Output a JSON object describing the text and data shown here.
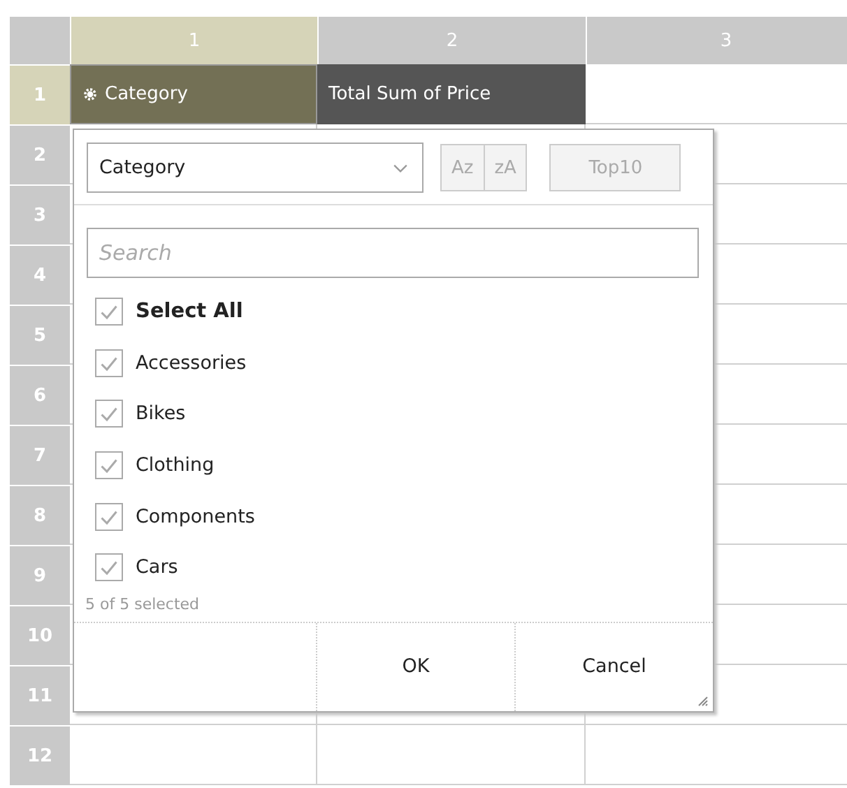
{
  "grid": {
    "columns": [
      {
        "label": "1",
        "selected": true
      },
      {
        "label": "2",
        "selected": false
      },
      {
        "label": "3",
        "selected": false
      }
    ],
    "rows": [
      {
        "label": "1",
        "selected": true
      },
      {
        "label": "2",
        "selected": false
      },
      {
        "label": "3",
        "selected": false
      },
      {
        "label": "4",
        "selected": false
      },
      {
        "label": "5",
        "selected": false
      },
      {
        "label": "6",
        "selected": false
      },
      {
        "label": "7",
        "selected": false
      },
      {
        "label": "8",
        "selected": false
      },
      {
        "label": "9",
        "selected": false
      },
      {
        "label": "10",
        "selected": false
      },
      {
        "label": "11",
        "selected": false
      },
      {
        "label": "12",
        "selected": false
      }
    ],
    "header_cells": [
      {
        "text": "Category",
        "kind": "field"
      },
      {
        "text": "Total Sum of Price",
        "kind": "value"
      }
    ]
  },
  "filter_popup": {
    "field": "Category",
    "sort_buttons": [
      "Az",
      "zA"
    ],
    "top_button": "Top10",
    "search": {
      "placeholder": "Search"
    },
    "items": [
      {
        "label": "Select All",
        "checked": true,
        "kind": "all"
      },
      {
        "label": "Accessories",
        "checked": true,
        "kind": "item"
      },
      {
        "label": "Bikes",
        "checked": true,
        "kind": "item"
      },
      {
        "label": "Clothing",
        "checked": true,
        "kind": "item"
      },
      {
        "label": "Components",
        "checked": true,
        "kind": "item"
      },
      {
        "label": "Cars",
        "checked": true,
        "kind": "item"
      }
    ],
    "status": "5 of 5 selected",
    "buttons": [
      "OK",
      "Cancel"
    ]
  }
}
